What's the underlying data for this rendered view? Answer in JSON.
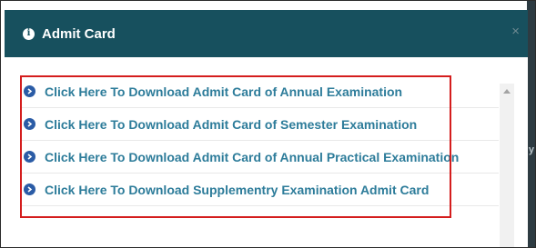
{
  "modal": {
    "title": "Admit Card",
    "close_glyph": "×",
    "info_glyph": "i"
  },
  "links": [
    {
      "label": "Click Here To Download Admit Card of Annual Examination"
    },
    {
      "label": "Click Here To Download Admit Card of Semester Examination"
    },
    {
      "label": "Click Here To Download Admit Card of Annual Practical Examination"
    },
    {
      "label": "Click Here To Download Supplementry Examination Admit Card"
    }
  ],
  "icons": {
    "header": "info-circle-icon",
    "list_item": "chevron-circle-right-icon",
    "close": "close-icon"
  },
  "colors": {
    "header_bg": "#17505e",
    "link_text": "#2d7c9a",
    "arrow_icon": "#2b5ca6",
    "highlight_border": "#d41d1d"
  },
  "backdrop": {
    "visible_char": "y"
  }
}
